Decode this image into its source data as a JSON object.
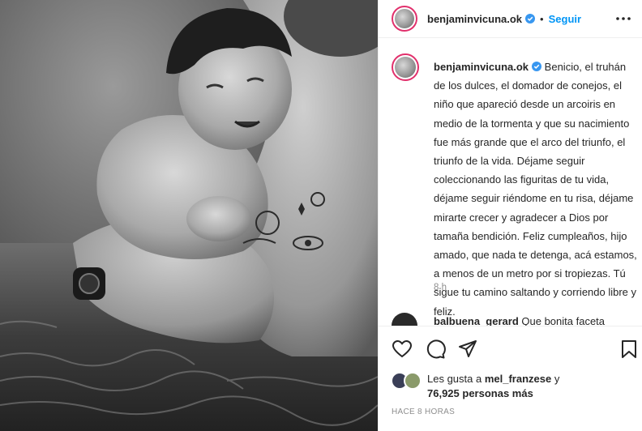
{
  "post": {
    "author": "benjaminvicuna.ok",
    "follow_label": "Seguir",
    "separator": "•",
    "caption": "Benicio, el truhán de los dulces, el domador de conejos, el niño que apareció desde un arcoiris en medio de la tormenta y que su nacimiento fue más grande que el arco del triunfo, el triunfo de la vida. Déjame seguir coleccionando las figuritas de tu vida, déjame seguir riéndome en tu risa, déjame mirarte crecer y agradecer a Dios por tamaña bendición. Feliz cumpleaños, hijo amado, que nada te detenga, acá estamos, a menos de un metro por si tropiezas. Tú sigue tu camino saltando y corriendo libre y feliz.",
    "caption_time": "8 h",
    "posted_ago": "HACE 8 HORAS"
  },
  "comment": {
    "user": "balbuena_gerard",
    "text": "Que bonita faceta"
  },
  "likes": {
    "prefix": "Les gusta a",
    "user": "mel_franzese",
    "suffix": "y",
    "count_text": "76,925 personas más"
  },
  "icons": {
    "verified": "verified-badge-icon",
    "more": "more-options-icon",
    "like": "heart-icon",
    "comment": "comment-icon",
    "share": "share-icon",
    "save": "bookmark-icon"
  },
  "colors": {
    "follow": "#0095f6",
    "verified": "#3897f0",
    "story_ring": "#e1306c",
    "muted": "#8e8e8e"
  }
}
